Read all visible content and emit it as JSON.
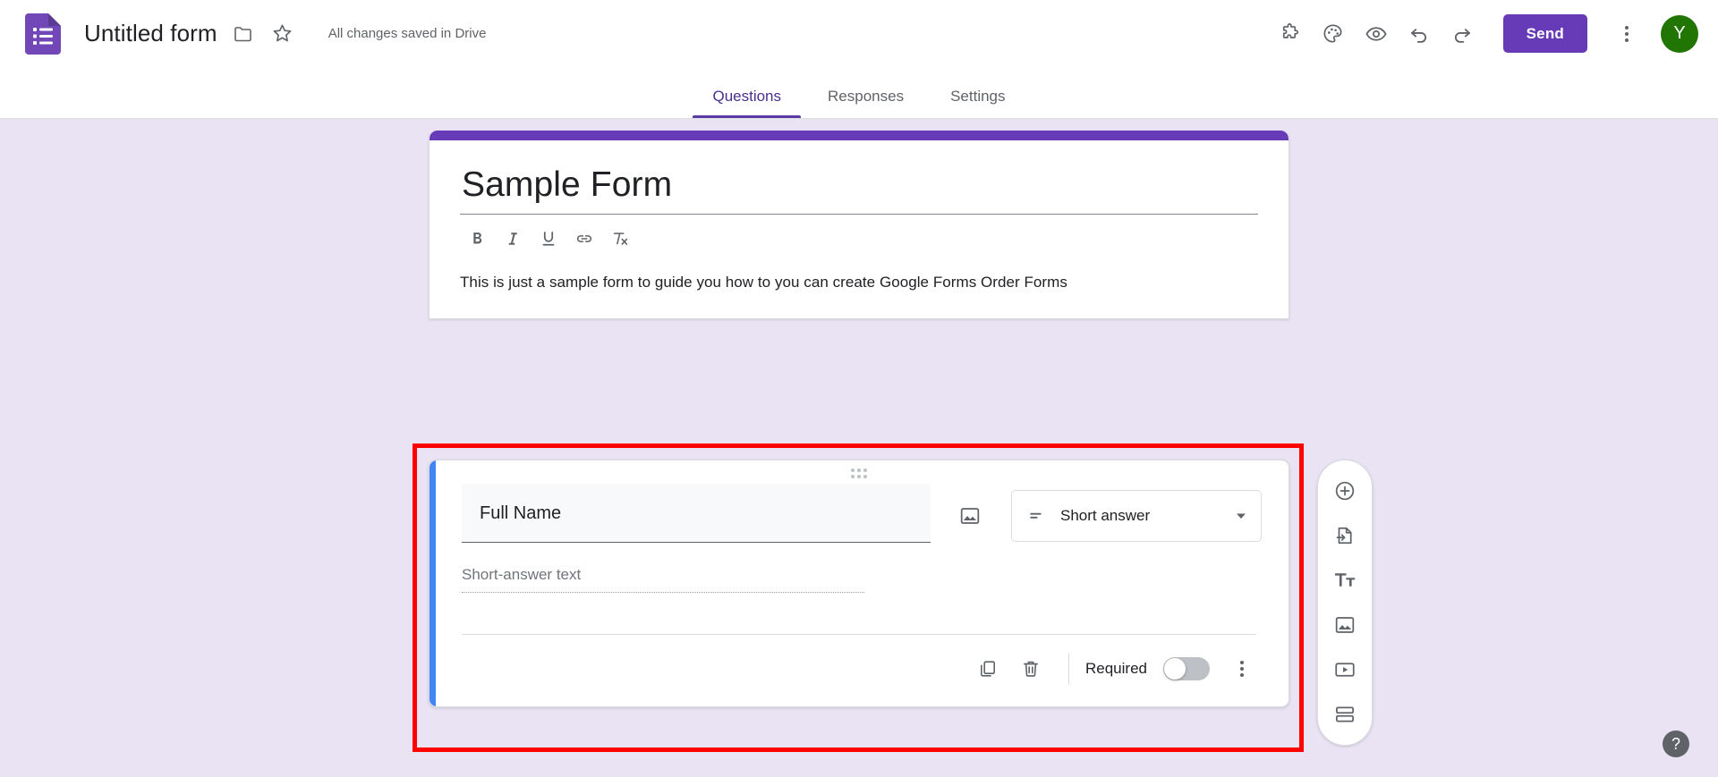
{
  "topbar": {
    "logo_icon": "google-forms-logo-icon",
    "doc_title": "Untitled form",
    "move_folder_icon": "folder-icon",
    "star_icon": "star-outline-icon",
    "save_status": "All changes saved in Drive",
    "actions": [
      {
        "icon": "addons-puzzle-icon",
        "label": "Add-ons"
      },
      {
        "icon": "palette-icon",
        "label": "Customize theme"
      },
      {
        "icon": "eye-preview-icon",
        "label": "Preview"
      },
      {
        "icon": "undo-icon",
        "label": "Undo"
      },
      {
        "icon": "redo-icon",
        "label": "Redo"
      }
    ],
    "send_label": "Send",
    "more_icon": "more-vert-icon",
    "avatar_initial": "Y",
    "avatar_color": "#217503",
    "brand_color": "#673ab7"
  },
  "tabs": [
    {
      "label": "Questions",
      "active": true
    },
    {
      "label": "Responses",
      "active": false
    },
    {
      "label": "Settings",
      "active": false
    }
  ],
  "form_header": {
    "stripe_color": "#673ab7",
    "title": "Sample Form",
    "description": "This is just a sample form to guide you how to you can create Google Forms Order Forms",
    "rte_buttons": [
      {
        "icon": "bold-icon",
        "glyph": "B"
      },
      {
        "icon": "italic-icon",
        "glyph": "I"
      },
      {
        "icon": "underline-icon",
        "glyph": "U"
      },
      {
        "icon": "link-icon",
        "glyph": "link"
      },
      {
        "icon": "clear-formatting-icon",
        "glyph": "clear"
      }
    ]
  },
  "question": {
    "drag_handle_icon": "drag-handle-dots-icon",
    "title": "Full Name",
    "image_icon": "add-image-icon",
    "type_icon": "short-answer-icon",
    "type_label": "Short answer",
    "dropdown_icon": "chevron-down-icon",
    "answer_placeholder": "Short-answer text",
    "duplicate_icon": "duplicate-icon",
    "delete_icon": "trash-icon",
    "required_label": "Required",
    "required_on": false,
    "more_icon": "more-vert-icon",
    "selection_color": "#4285f4"
  },
  "side_toolbar": [
    {
      "icon": "add-question-icon",
      "label": "Add question"
    },
    {
      "icon": "import-questions-icon",
      "label": "Import questions"
    },
    {
      "icon": "add-title-description-icon",
      "label": "Add title and description"
    },
    {
      "icon": "add-image-icon",
      "label": "Add image"
    },
    {
      "icon": "add-video-icon",
      "label": "Add video"
    },
    {
      "icon": "add-section-icon",
      "label": "Add section"
    }
  ],
  "annotation": {
    "highlight_color": "#ff0000"
  },
  "help": {
    "icon": "help-question-icon",
    "glyph": "?"
  }
}
